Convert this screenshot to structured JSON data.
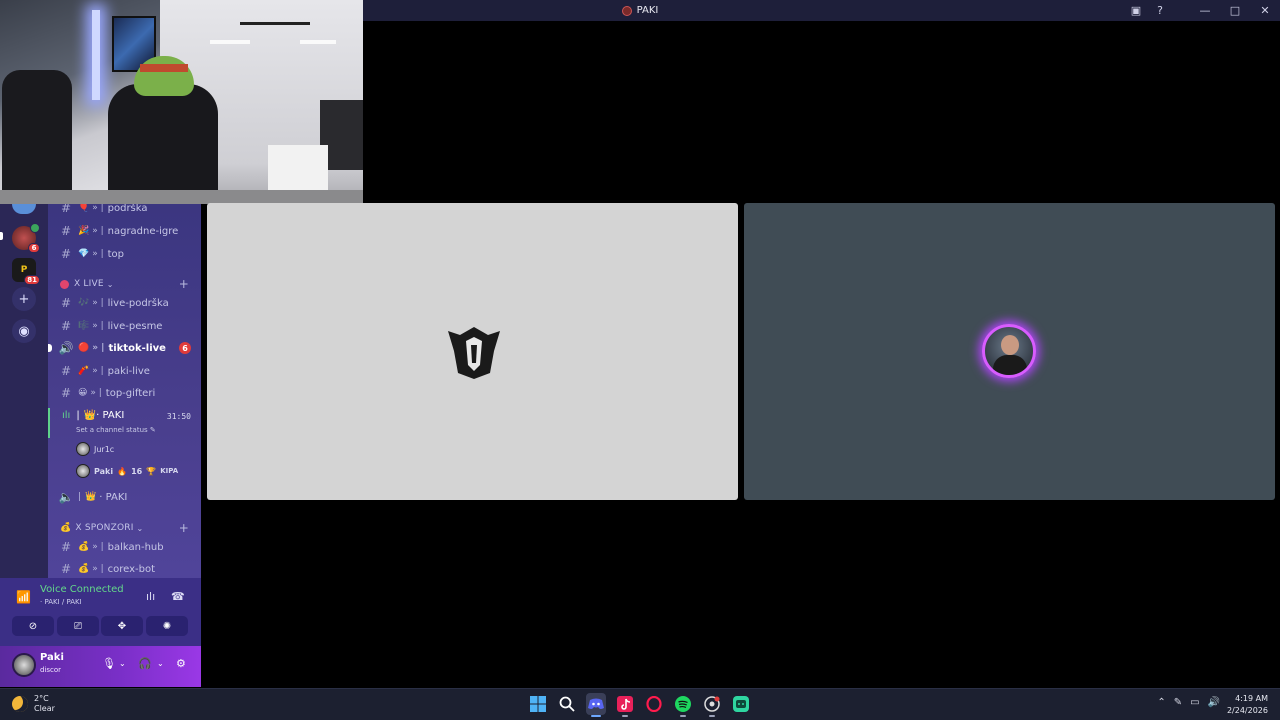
{
  "window": {
    "title": "PAKI",
    "controls": [
      "cast-icon",
      "help-icon",
      "minimize-icon",
      "maximize-icon",
      "close-icon"
    ]
  },
  "servers": [
    {
      "name": "server-1",
      "color": "#5a8fd8"
    },
    {
      "name": "server-2",
      "color": "#8a3b3b",
      "badge": "6"
    },
    {
      "name": "server-3",
      "color": "#f0c419",
      "badge": "81",
      "label": "P"
    }
  ],
  "sidebar": {
    "channels_top": [
      {
        "emoji": "🎈",
        "name": "podrška"
      },
      {
        "emoji": "🎉",
        "name": "nagradne-igre"
      },
      {
        "emoji": "💎",
        "name": "top"
      }
    ],
    "category_live": {
      "label": "X LIVE",
      "dot_color": "#e0456d"
    },
    "channels_live": [
      {
        "emoji": "🎶",
        "name": "live-podrška"
      },
      {
        "emoji": "🎼",
        "name": "live-pesme"
      },
      {
        "emoji": "🔴",
        "name": "tiktok-live",
        "active": true,
        "badge": "6"
      },
      {
        "emoji": "🧨",
        "name": "paki-live"
      },
      {
        "emoji": "😀",
        "name": "top-gifteri"
      }
    ],
    "voice_channel": {
      "name": "· PAKI",
      "emoji": "👑",
      "timer": "31:50",
      "status": "Set a channel status",
      "users": [
        {
          "name": "Jur1c"
        },
        {
          "name": "Paki",
          "extra": "16",
          "tag": "KIPA"
        }
      ]
    },
    "voice_channel_2": {
      "name": "· PAKI",
      "emoji": "👑"
    },
    "category_sponzori": {
      "label": "X SPONZORI",
      "emoji": "💰"
    },
    "channels_sponzori": [
      {
        "emoji": "💰",
        "name": "balkan-hub"
      },
      {
        "emoji": "💰",
        "name": "corex-bot"
      }
    ]
  },
  "voice_panel": {
    "status": "Voice Connected",
    "channel": "· PAKI / PAKI"
  },
  "user_panel": {
    "name": "Paki",
    "status": "discor"
  },
  "stage": {
    "left_bg": "#d4d4d4",
    "right_bg": "#404c55",
    "speaking_ring": "#d85cff"
  },
  "taskbar": {
    "temperature": "2°C",
    "condition": "Clear",
    "time": "4:19 AM",
    "date": "2/24/2026",
    "apps": [
      "windows-start-icon",
      "search-icon",
      "discord-icon",
      "tiktok-icon",
      "opera-icon",
      "spotify-icon",
      "chrome-icon",
      "app-icon"
    ]
  }
}
